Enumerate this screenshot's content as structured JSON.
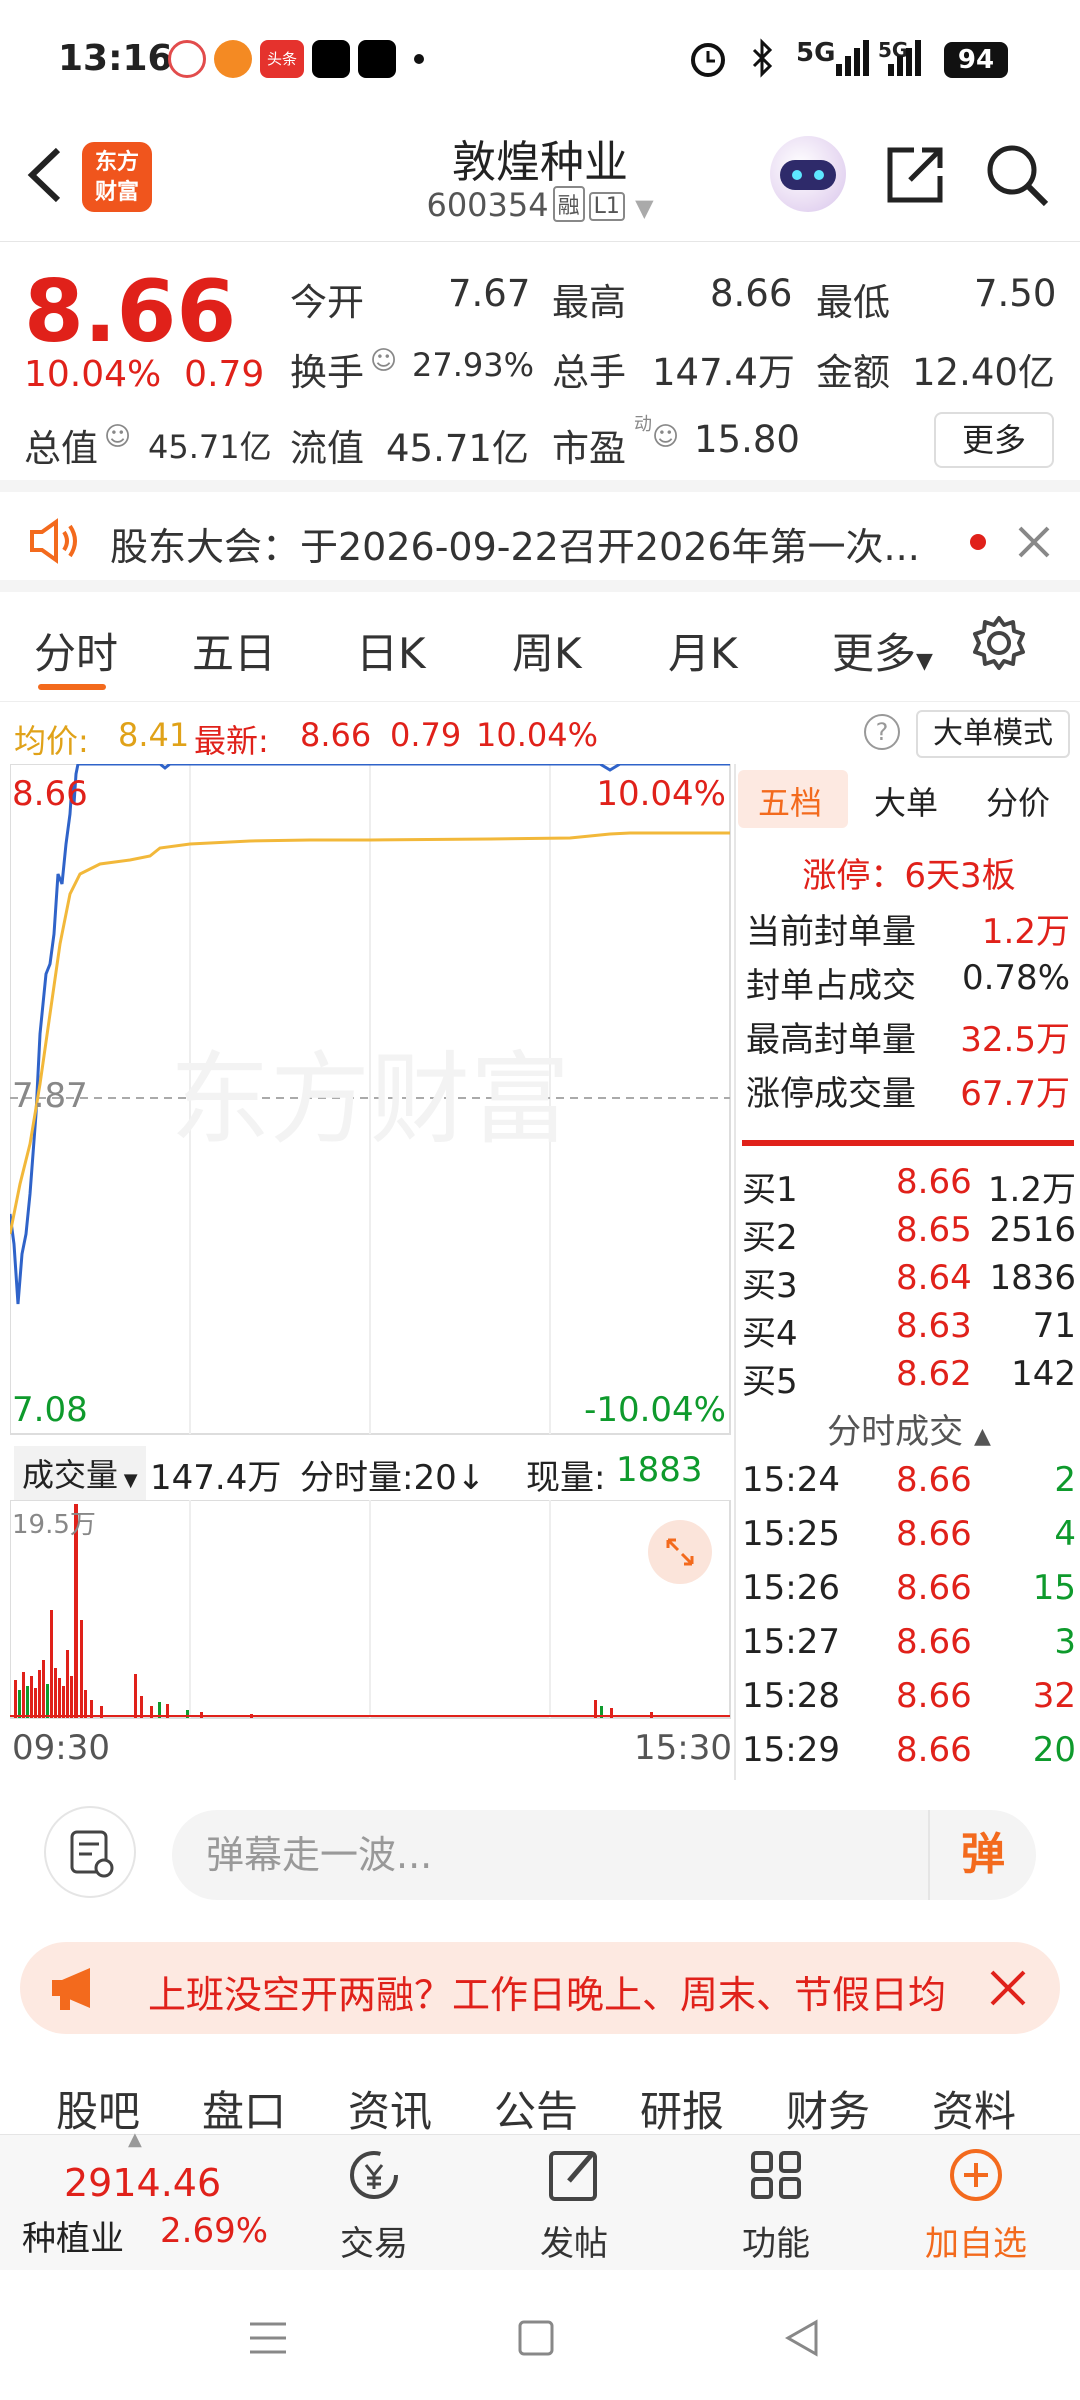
{
  "status_bar": {
    "time": "13:16",
    "sig1": "5G",
    "sig2": "5G",
    "battery": "94",
    "app_badge": "头条"
  },
  "header": {
    "logo_line1": "东方",
    "logo_line2": "财富",
    "title": "敦煌种业",
    "code": "600354",
    "tag1": "融",
    "tag2": "L1"
  },
  "quote": {
    "price": "8.66",
    "pct": "10.04%",
    "chg": "0.79",
    "open_label": "今开",
    "open": "7.67",
    "high_label": "最高",
    "high": "8.66",
    "low_label": "最低",
    "low": "7.50",
    "turnover_label": "换手",
    "turnover": "27.93%",
    "vol_label": "总手",
    "vol": "147.4万",
    "amount_label": "金额",
    "amount": "12.40亿",
    "mcap_label": "总值",
    "mcap": "45.71亿",
    "float_label": "流值",
    "float": "45.71亿",
    "pe_label": "市盈",
    "pe_sup": "动",
    "pe": "15.80",
    "more": "更多"
  },
  "notice": {
    "text": "股东大会：于2026-09-22召开2026年第一次..."
  },
  "tabs": [
    "分时",
    "五日",
    "日K",
    "周K",
    "月K",
    "更多"
  ],
  "info": {
    "avg_label": "均价:",
    "avg": "8.41",
    "latest_label": "最新:",
    "latest": "8.66",
    "chg": "0.79",
    "pct": "10.04%",
    "big_mode": "大单模式"
  },
  "chart": {
    "top_price": "8.66",
    "top_pct": "10.04%",
    "mid_price": "7.87",
    "bottom_price": "7.08",
    "bottom_pct": "-10.04%",
    "watermark": "东方财富",
    "start": "09:30",
    "end": "15:30"
  },
  "volume": {
    "label": "成交量",
    "total": "147.4万",
    "mode": "分时量:20↓",
    "current_label": "现量:",
    "current": "1883",
    "max": "19.5万"
  },
  "depth": {
    "tabs": [
      "五档",
      "大单",
      "分价"
    ],
    "limit_label": "涨停：",
    "limit_value": "6天3板",
    "stats": [
      {
        "label": "当前封单量",
        "value": "1.2万"
      },
      {
        "label": "封单占成交",
        "value": "0.78%"
      },
      {
        "label": "最高封单量",
        "value": "32.5万"
      },
      {
        "label": "涨停成交量",
        "value": "67.7万"
      }
    ],
    "bids": [
      {
        "label": "买1",
        "price": "8.66",
        "qty": "1.2万"
      },
      {
        "label": "买2",
        "price": "8.65",
        "qty": "2516"
      },
      {
        "label": "买3",
        "price": "8.64",
        "qty": "1836"
      },
      {
        "label": "买4",
        "price": "8.63",
        "qty": "71"
      },
      {
        "label": "买5",
        "price": "8.62",
        "qty": "142"
      }
    ],
    "trades_title": "分时成交",
    "trades": [
      {
        "time": "15:24",
        "price": "8.66",
        "qty": "2"
      },
      {
        "time": "15:25",
        "price": "8.66",
        "qty": "4"
      },
      {
        "time": "15:26",
        "price": "8.66",
        "qty": "15"
      },
      {
        "time": "15:27",
        "price": "8.66",
        "qty": "3"
      },
      {
        "time": "15:28",
        "price": "8.66",
        "qty": "32"
      },
      {
        "time": "15:29",
        "price": "8.66",
        "qty": "20"
      }
    ]
  },
  "danmu": {
    "placeholder": "弹幕走一波...",
    "btn": "弹"
  },
  "banner": {
    "text": "上班没空开两融？工作日晚上、周末、节假日均"
  },
  "subtabs": [
    "股吧",
    "盘口",
    "资讯",
    "公告",
    "研报",
    "财务",
    "资料"
  ],
  "bottom": {
    "index_value": "2914.46",
    "index_name": "种植业",
    "index_pct": "2.69%",
    "trade": "交易",
    "post": "发帖",
    "func": "功能",
    "add": "加自选"
  },
  "colors": {
    "accent": "#f36a1d",
    "up": "#e0211a",
    "down": "#0e9a2c",
    "price_line": "#2f63c9",
    "avg_line": "#f2b83a"
  }
}
